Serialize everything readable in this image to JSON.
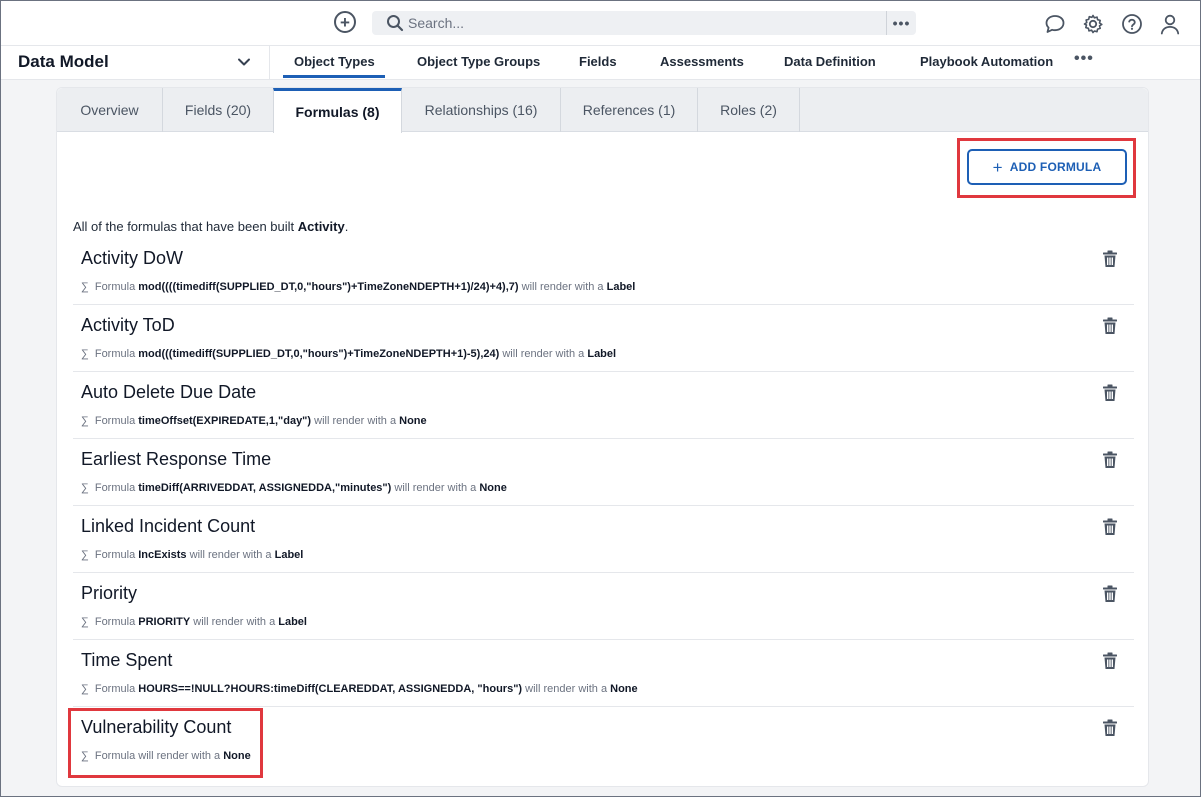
{
  "topbar": {
    "search_placeholder": "Search...",
    "more_label": "•••",
    "icons": [
      "add-circle-icon",
      "search-icon",
      "chat-icon",
      "gear-icon",
      "help-icon",
      "user-icon"
    ]
  },
  "nav": {
    "title": "Data Model",
    "tabs": [
      {
        "label": "Object Types",
        "active": true
      },
      {
        "label": "Object Type Groups"
      },
      {
        "label": "Fields"
      },
      {
        "label": "Assessments"
      },
      {
        "label": "Data Definition"
      },
      {
        "label": "Playbook Automation"
      }
    ],
    "more_label": "•••"
  },
  "subtabs": [
    {
      "label": "Overview"
    },
    {
      "label": "Fields (20)"
    },
    {
      "label": "Formulas (8)",
      "active": true
    },
    {
      "label": "Relationships (16)"
    },
    {
      "label": "References (1)"
    },
    {
      "label": "Roles (2)"
    }
  ],
  "add_button": {
    "plus": "+",
    "label": "ADD FORMULA"
  },
  "intro": {
    "prefix": "All of the formulas that have been built ",
    "object": "Activity",
    "suffix": "."
  },
  "formula_meta": {
    "sigma": "∑",
    "formula_word": "Formula",
    "render_text": "will render with a"
  },
  "formulas": [
    {
      "name": "Activity DoW",
      "expression": "mod((((timediff(SUPPLIED_DT,0,\"hours\")+TimeZoneNDEPTH+1)/24)+4),7)",
      "render": "Label"
    },
    {
      "name": "Activity ToD",
      "expression": "mod(((timediff(SUPPLIED_DT,0,\"hours\")+TimeZoneNDEPTH+1)-5),24)",
      "render": "Label"
    },
    {
      "name": "Auto Delete Due Date",
      "expression": "timeOffset(EXPIREDATE,1,\"day\")",
      "render": "None"
    },
    {
      "name": "Earliest Response Time",
      "expression": "timeDiff(ARRIVEDDAT, ASSIGNEDDA,\"minutes\")",
      "render": "None"
    },
    {
      "name": "Linked Incident Count",
      "expression": "IncExists",
      "render": "Label"
    },
    {
      "name": "Priority",
      "expression": "PRIORITY",
      "render": "Label"
    },
    {
      "name": "Time Spent",
      "expression": "HOURS==!NULL?HOURS:timeDiff(CLEAREDDAT, ASSIGNEDDA, \"hours\")",
      "render": "None"
    },
    {
      "name": "Vulnerability Count",
      "expression": "",
      "render": "None"
    }
  ],
  "colors": {
    "accent": "#1d5fb5",
    "highlight": "#e0383e"
  }
}
